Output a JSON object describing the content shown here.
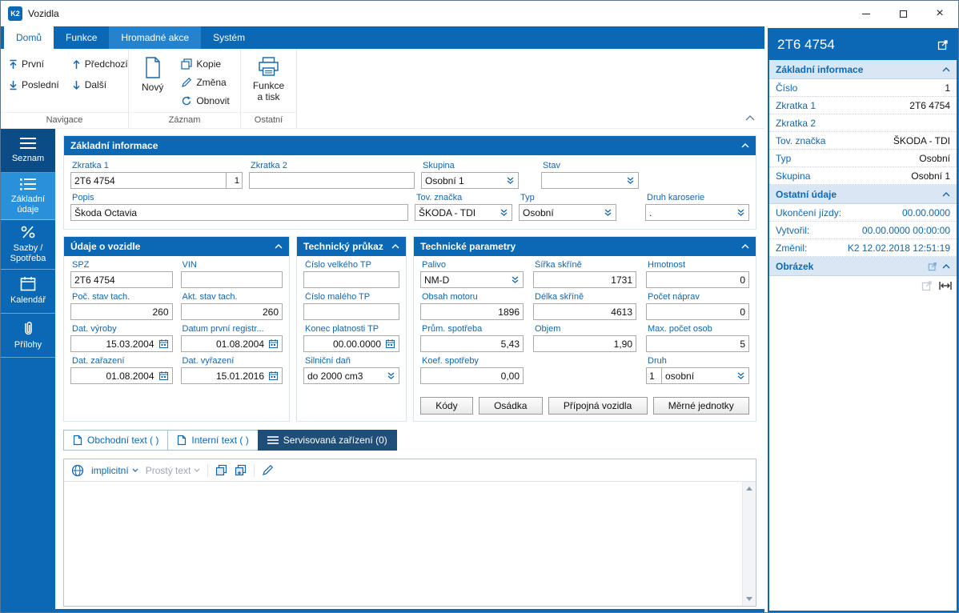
{
  "colors": {
    "primary_blue": "#0a68b4",
    "sidebar_selected": "#2991da",
    "tab_dark": "#1f4e79",
    "label_blue": "#1565a9",
    "panel_header_bg": "#d9e7f5"
  },
  "window": {
    "logo": "K2",
    "title": "Vozidla"
  },
  "ribbon": {
    "tabs": [
      {
        "label": "Domů"
      },
      {
        "label": "Funkce"
      },
      {
        "label": "Hromadné akce"
      },
      {
        "label": "Systém"
      }
    ],
    "groups": {
      "navigace": {
        "label": "Navigace",
        "prvni": "První",
        "posledni": "Poslední",
        "predchozi": "Předchozí",
        "dalsi": "Další"
      },
      "zaznam": {
        "label": "Záznam",
        "novy": "Nový",
        "kopie": "Kopie",
        "zmena": "Změna",
        "obnovit": "Obnovit"
      },
      "ostatni": {
        "label": "Ostatní",
        "funkce_a_tisk": "Funkce a tisk"
      }
    }
  },
  "sidebar": {
    "items": [
      {
        "label": "Seznam"
      },
      {
        "label": "Základní údaje"
      },
      {
        "label": "Sazby / Spotřeba"
      },
      {
        "label": "Kalendář"
      },
      {
        "label": "Přílohy"
      }
    ]
  },
  "main": {
    "zakladni_informace": {
      "title": "Základní informace",
      "zkratka1_label": "Zkratka 1",
      "zkratka1_value": "2T6 4754",
      "zkratka1_seq": "1",
      "zkratka2_label": "Zkratka 2",
      "zkratka2_value": "",
      "skupina_label": "Skupina",
      "skupina_value": "Osobní 1",
      "stav_label": "Stav",
      "stav_value": "",
      "popis_label": "Popis",
      "popis_value": "Škoda Octavia",
      "tov_znacka_label": "Tov. značka",
      "tov_znacka_value": "ŠKODA - TDI",
      "typ_label": "Typ",
      "typ_value": "Osobní",
      "druh_karoserie_label": "Druh karoserie",
      "druh_karoserie_value": "."
    },
    "udaje_o_vozidle": {
      "title": "Údaje o vozidle",
      "spz_label": "SPZ",
      "spz_value": "2T6 4754",
      "vin_label": "VIN",
      "vin_value": "",
      "poc_stav_label": "Poč. stav tach.",
      "poc_stav_value": "260",
      "akt_stav_label": "Akt. stav tach.",
      "akt_stav_value": "260",
      "dat_vyroby_label": "Dat. výroby",
      "dat_vyroby_value": "15.03.2004",
      "datum_prvni_label": "Datum první registr...",
      "datum_prvni_value": "01.08.2004",
      "dat_zarazeni_label": "Dat. zařazení",
      "dat_zarazeni_value": "01.08.2004",
      "dat_vyrazeni_label": "Dat. vyřazení",
      "dat_vyrazeni_value": "15.01.2016"
    },
    "technicky_prukaz": {
      "title": "Technický průkaz",
      "velke_tp_label": "Číslo velkého TP",
      "velke_tp_value": "",
      "male_tp_label": "Číslo malého TP",
      "male_tp_value": "",
      "konec_tp_label": "Konec platnosti TP",
      "konec_tp_value": "00.00.0000",
      "silnicni_dan_label": "Silniční daň",
      "silnicni_dan_value": "do 2000 cm3"
    },
    "technicke_parametry": {
      "title": "Technické parametry",
      "palivo_label": "Palivo",
      "palivo_value": "NM-D",
      "sirka_label": "Šířka skříně",
      "sirka_value": "1731",
      "hmotnost_label": "Hmotnost",
      "hmotnost_value": "0",
      "obsah_label": "Obsah motoru",
      "obsah_value": "1896",
      "delka_label": "Délka skříně",
      "delka_value": "4613",
      "napravy_label": "Počet náprav",
      "napravy_value": "0",
      "spotreba_label": "Prům. spotřeba",
      "spotreba_value": "5,43",
      "objem_label": "Objem",
      "objem_value": "1,90",
      "max_osob_label": "Max. počet osob",
      "max_osob_value": "5",
      "koef_label": "Koef. spotřeby",
      "koef_value": "0,00",
      "druh_label": "Druh",
      "druh_num": "1",
      "druh_value": "osobní",
      "buttons": [
        "Kódy",
        "Osádka",
        "Přípojná vozidla",
        "Měrné jednotky"
      ]
    },
    "tabs": [
      {
        "label": "Obchodní text ( )"
      },
      {
        "label": "Interní text ( )"
      },
      {
        "label": "Servisovaná zařízení (0)"
      }
    ],
    "editor": {
      "language": "implicitní",
      "mode": "Prostý text",
      "content": ""
    }
  },
  "right_panel": {
    "title": "2T6 4754",
    "zakladni": {
      "title": "Základní informace",
      "rows": [
        {
          "label": "Číslo",
          "value": "1"
        },
        {
          "label": "Zkratka 1",
          "value": "2T6 4754"
        },
        {
          "label": "Zkratka 2",
          "value": ""
        },
        {
          "label": "Tov. značka",
          "value": "ŠKODA - TDI"
        },
        {
          "label": "Typ",
          "value": "Osobní"
        },
        {
          "label": "Skupina",
          "value": "Osobní 1"
        }
      ]
    },
    "ostatni": {
      "title": "Ostatní údaje",
      "rows": [
        {
          "label": "Ukončení jízdy:",
          "value": "00.00.0000"
        },
        {
          "label": "Vytvořil:",
          "value": "00.00.0000 00:00:00"
        },
        {
          "label": "Změnil:",
          "value": "K2 12.02.2018 12:51:19"
        }
      ]
    },
    "obrazek": {
      "title": "Obrázek"
    }
  }
}
